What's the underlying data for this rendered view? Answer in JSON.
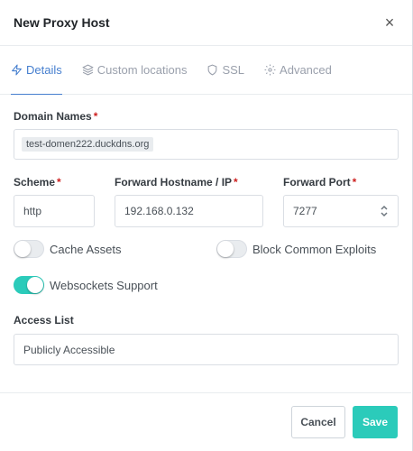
{
  "header": {
    "title": "New Proxy Host",
    "close_symbol": "×"
  },
  "tabs": [
    {
      "label": "Details",
      "icon": "bolt-icon",
      "active": true
    },
    {
      "label": "Custom locations",
      "icon": "layers-icon",
      "active": false
    },
    {
      "label": "SSL",
      "icon": "shield-icon",
      "active": false
    },
    {
      "label": "Advanced",
      "icon": "gear-icon",
      "active": false
    }
  ],
  "form": {
    "domain_names": {
      "label": "Domain Names",
      "required_mark": "*",
      "tags": [
        "test-domen222.duckdns.org"
      ]
    },
    "scheme": {
      "label": "Scheme",
      "required_mark": "*",
      "value": "http"
    },
    "forward_host": {
      "label": "Forward Hostname / IP",
      "required_mark": "*",
      "value": "192.168.0.132"
    },
    "forward_port": {
      "label": "Forward Port",
      "required_mark": "*",
      "value": "7277"
    },
    "toggles": {
      "cache_assets": {
        "label": "Cache Assets",
        "on": false
      },
      "block_exploits": {
        "label": "Block Common Exploits",
        "on": false
      },
      "websockets": {
        "label": "Websockets Support",
        "on": true
      }
    },
    "access_list": {
      "label": "Access List",
      "value": "Publicly Accessible"
    }
  },
  "footer": {
    "cancel_label": "Cancel",
    "save_label": "Save"
  },
  "colors": {
    "accent": "#467fcf",
    "teal": "#2bcbba",
    "required": "#cd201f"
  }
}
